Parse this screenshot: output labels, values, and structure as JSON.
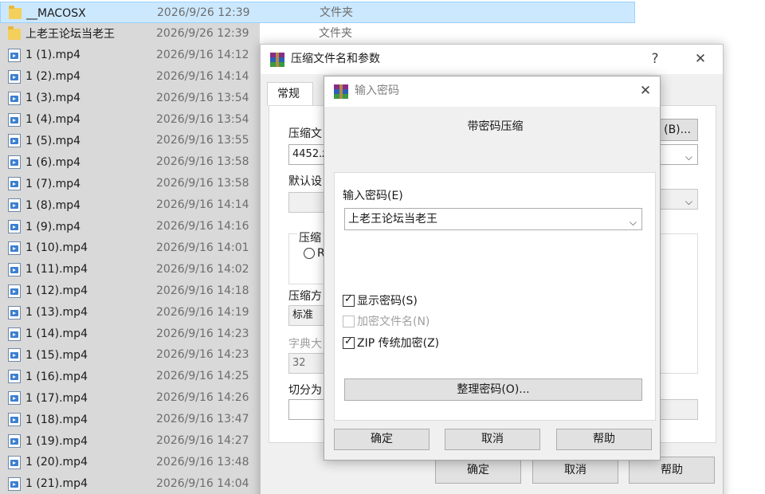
{
  "files": [
    {
      "name": "__MACOSX",
      "date": "2026/9/26 12:39",
      "type": "文件夹",
      "icon": "folder-icon",
      "selected": true
    },
    {
      "name": "上老王论坛当老王",
      "date": "2026/9/26 12:39",
      "type": "文件夹",
      "icon": "folder-icon",
      "selected": true
    },
    {
      "name": "1 (1).mp4",
      "date": "2026/9/16 14:12",
      "type": "",
      "icon": "video-file-icon",
      "selected": true
    },
    {
      "name": "1 (2).mp4",
      "date": "2026/9/16 14:14",
      "type": "",
      "icon": "video-file-icon",
      "selected": true
    },
    {
      "name": "1 (3).mp4",
      "date": "2026/9/16 13:54",
      "type": "",
      "icon": "video-file-icon",
      "selected": true
    },
    {
      "name": "1 (4).mp4",
      "date": "2026/9/16 13:54",
      "type": "",
      "icon": "video-file-icon",
      "selected": true
    },
    {
      "name": "1 (5).mp4",
      "date": "2026/9/16 13:55",
      "type": "",
      "icon": "video-file-icon",
      "selected": true
    },
    {
      "name": "1 (6).mp4",
      "date": "2026/9/16 13:58",
      "type": "",
      "icon": "video-file-icon",
      "selected": true
    },
    {
      "name": "1 (7).mp4",
      "date": "2026/9/16 13:58",
      "type": "",
      "icon": "video-file-icon",
      "selected": true
    },
    {
      "name": "1 (8).mp4",
      "date": "2026/9/16 14:14",
      "type": "",
      "icon": "video-file-icon",
      "selected": true
    },
    {
      "name": "1 (9).mp4",
      "date": "2026/9/16 14:16",
      "type": "",
      "icon": "video-file-icon",
      "selected": true
    },
    {
      "name": "1 (10).mp4",
      "date": "2026/9/16 14:01",
      "type": "",
      "icon": "video-file-icon",
      "selected": true
    },
    {
      "name": "1 (11).mp4",
      "date": "2026/9/16 14:02",
      "type": "",
      "icon": "video-file-icon",
      "selected": true
    },
    {
      "name": "1 (12).mp4",
      "date": "2026/9/16 14:18",
      "type": "",
      "icon": "video-file-icon",
      "selected": true
    },
    {
      "name": "1 (13).mp4",
      "date": "2026/9/16 14:19",
      "type": "",
      "icon": "video-file-icon",
      "selected": true
    },
    {
      "name": "1 (14).mp4",
      "date": "2026/9/16 14:23",
      "type": "",
      "icon": "video-file-icon",
      "selected": true
    },
    {
      "name": "1 (15).mp4",
      "date": "2026/9/16 14:23",
      "type": "",
      "icon": "video-file-icon",
      "selected": true
    },
    {
      "name": "1 (16).mp4",
      "date": "2026/9/16 14:25",
      "type": "",
      "icon": "video-file-icon",
      "selected": true
    },
    {
      "name": "1 (17).mp4",
      "date": "2026/9/16 14:26",
      "type": "",
      "icon": "video-file-icon",
      "selected": true
    },
    {
      "name": "1 (18).mp4",
      "date": "2026/9/16 13:47",
      "type": "",
      "icon": "video-file-icon",
      "selected": true
    },
    {
      "name": "1 (19).mp4",
      "date": "2026/9/16 14:27",
      "type": "",
      "icon": "video-file-icon",
      "selected": true
    },
    {
      "name": "1 (20).mp4",
      "date": "2026/9/16 13:48",
      "type": "",
      "icon": "video-file-icon",
      "selected": true
    },
    {
      "name": "1 (21).mp4",
      "date": "2026/9/16 14:04",
      "type": "",
      "icon": "video-file-icon",
      "selected": true
    }
  ],
  "colors": {
    "selection_focus": "#cce8ff",
    "selection_focus_border": "#99d1ff",
    "selection_inactive": "#d9d9d9"
  },
  "archive_dialog": {
    "title": "压缩文件名和参数",
    "help_glyph": "?",
    "close_glyph": "✕",
    "tab_general": "常规",
    "archive_name_label": "压缩文",
    "archive_name_value": "4452.z",
    "browse_button": "(B)...",
    "default_profile_label": "默认设",
    "archive_format_label": "压缩",
    "format_radio_label": "R",
    "compression_method_label": "压缩方",
    "compression_method_value": "标准",
    "dictionary_size_label": "字典大",
    "dictionary_size_value": "32",
    "split_volumes_label": "切分为",
    "ok_button": "确定",
    "cancel_button": "取消",
    "help_button": "帮助"
  },
  "password_dialog": {
    "title": "输入密码",
    "close_glyph": "✕",
    "heading": "带密码压缩",
    "password_label": "输入密码(E)",
    "password_value": "上老王论坛当老王",
    "show_password_label": "显示密码(S)",
    "show_password_checked": true,
    "encrypt_names_label": "加密文件名(N)",
    "encrypt_names_checked": false,
    "encrypt_names_enabled": false,
    "zip_legacy_label": "ZIP 传统加密(Z)",
    "zip_legacy_checked": true,
    "organize_button": "整理密码(O)...",
    "ok_button": "确定",
    "cancel_button": "取消",
    "help_button": "帮助"
  }
}
